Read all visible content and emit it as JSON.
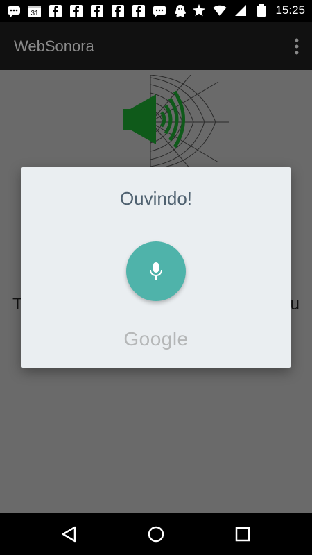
{
  "status_bar": {
    "time": "15:25",
    "left_icons": [
      "chat-icon",
      "calendar-icon",
      "facebook-icon",
      "facebook-icon",
      "facebook-icon",
      "facebook-icon",
      "facebook-icon",
      "message-icon",
      "ghost-icon"
    ],
    "calendar_day": "31",
    "right_icons": [
      "star-icon",
      "wifi-icon",
      "signal-icon",
      "battery-icon"
    ]
  },
  "app": {
    "title": "WebSonora",
    "bg_text_left": "T",
    "bg_text_right": "u"
  },
  "dialog": {
    "title": "Ouvindo!",
    "brand": "Google",
    "accent_color": "#4fb3aa"
  },
  "nav": [
    "back-icon",
    "home-icon",
    "recents-icon"
  ]
}
